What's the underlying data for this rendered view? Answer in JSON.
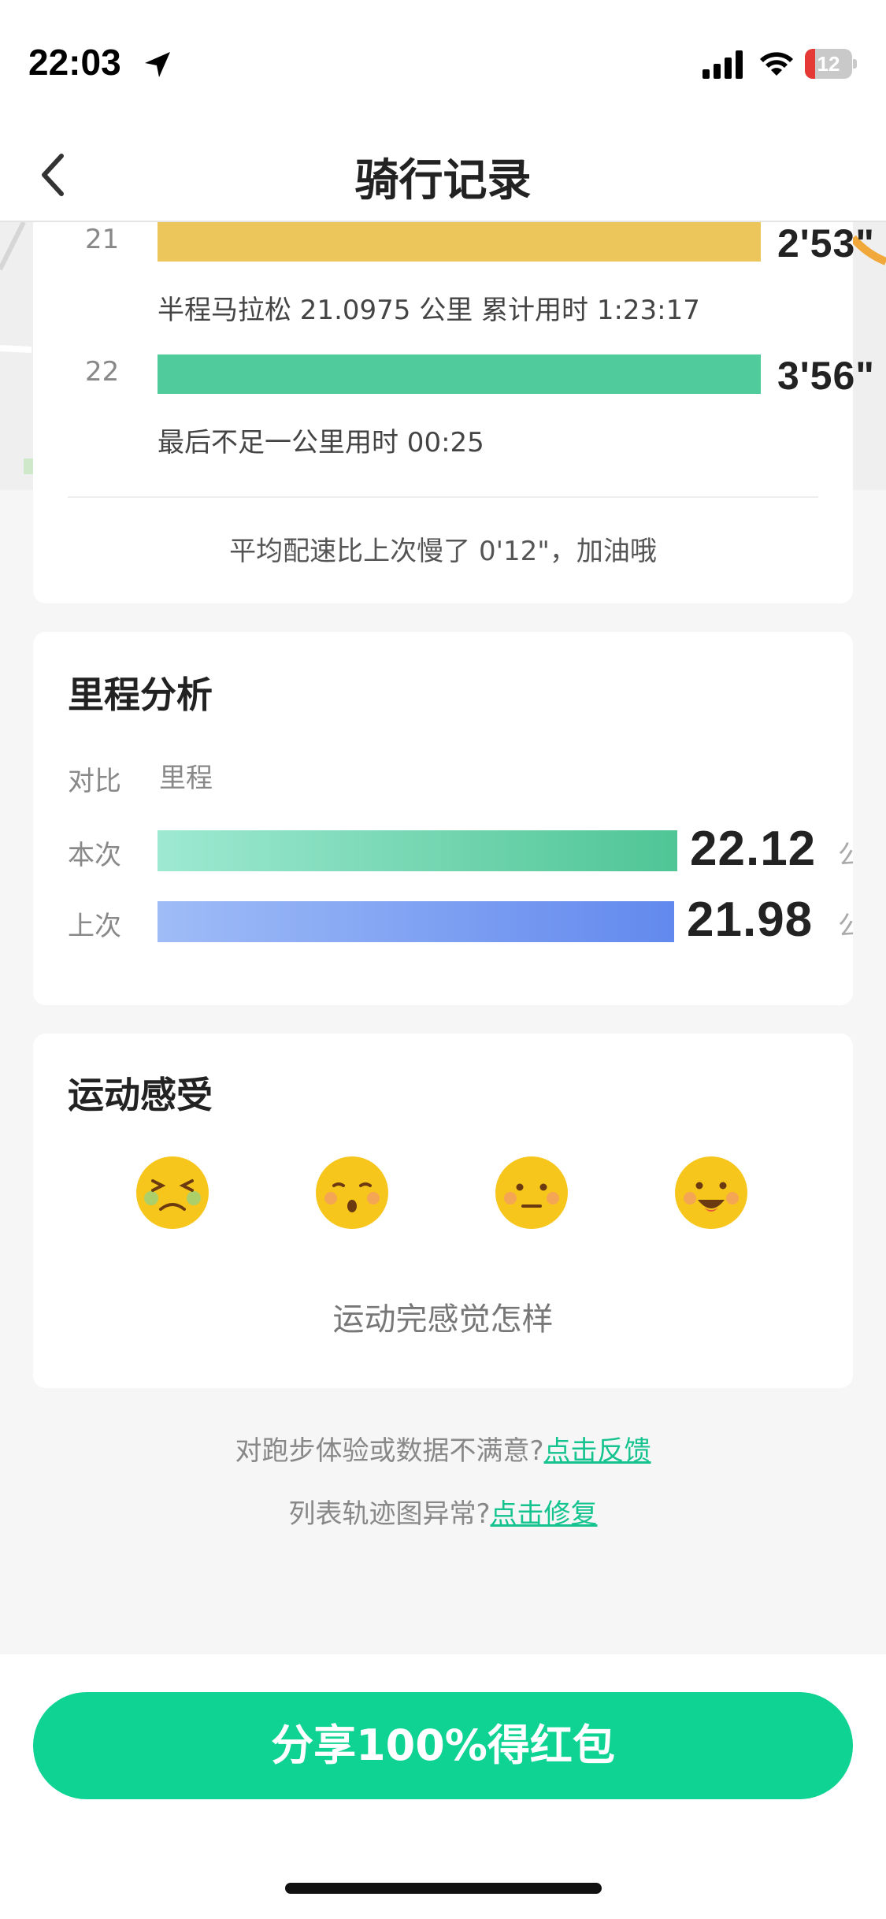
{
  "status_bar": {
    "time": "22:03",
    "battery": "12"
  },
  "nav": {
    "title": "骑行记录"
  },
  "pace": {
    "splits": [
      {
        "km": "21",
        "time": "2'53\"",
        "note": "半程马拉松 21.0975 公里 累计用时 1:23:17",
        "color": "#ecc65a"
      },
      {
        "km": "22",
        "time": "3'56\"",
        "note": "最后不足一公里用时 00:25",
        "color": "#4fcb9c"
      }
    ],
    "summary": "平均配速比上次慢了 0'12\"，加油哦"
  },
  "mileage": {
    "title": "里程分析",
    "header_compare": "对比",
    "header_metric": "里程",
    "rows": [
      {
        "label": "本次",
        "value": "22.12",
        "unit": "公",
        "fill": 1.0
      },
      {
        "label": "上次",
        "value": "21.98",
        "unit": "公",
        "fill": 0.994
      }
    ]
  },
  "feeling": {
    "title": "运动感受",
    "options": [
      "tired-face-icon",
      "surprised-face-icon",
      "neutral-face-icon",
      "happy-face-icon"
    ],
    "prompt": "运动完感觉怎样"
  },
  "footer": {
    "feedback_text": "对跑步体验或数据不满意?",
    "feedback_link": "点击反馈",
    "repair_text": "列表轨迹图异常?",
    "repair_link": "点击修复"
  },
  "share": {
    "label": "分享100%得红包"
  }
}
